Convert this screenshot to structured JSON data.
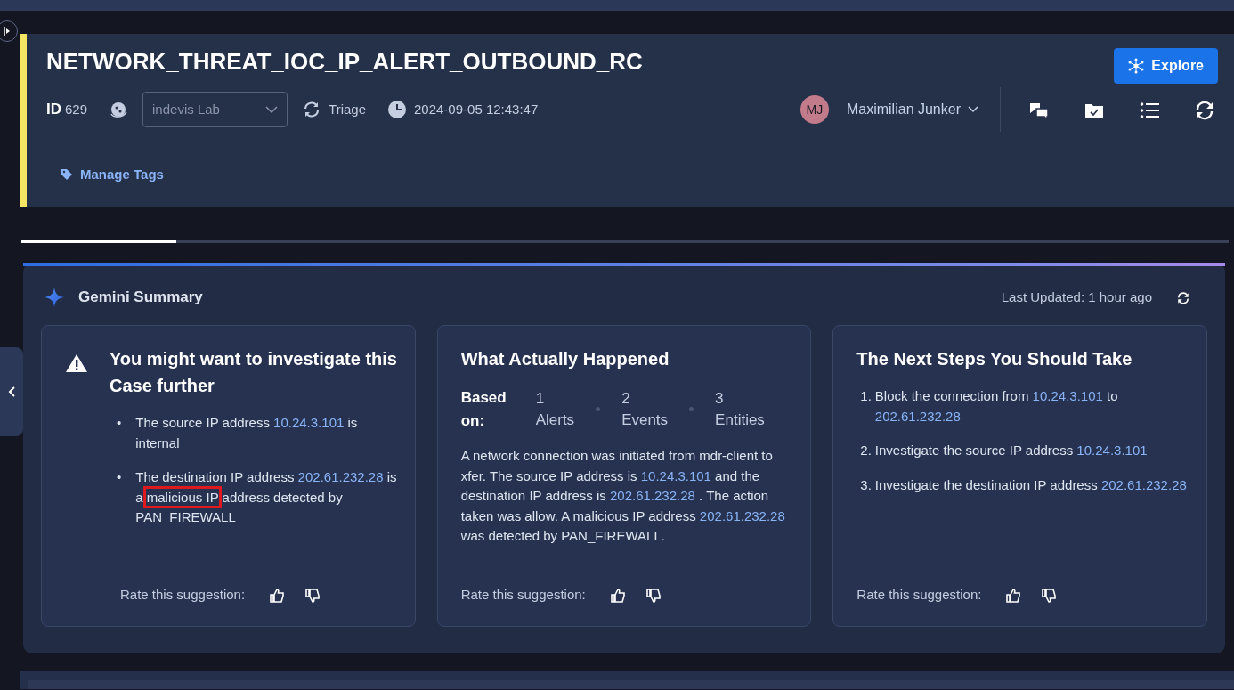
{
  "case": {
    "title": "NETWORK_THREAT_IOC_IP_ALERT_OUTBOUND_RC",
    "id_label": "ID",
    "id": "629",
    "environment": "indevis Lab",
    "stage": "Triage",
    "created": "2024-09-05 12:43:47",
    "assignee": {
      "initials": "MJ",
      "name": "Maximilian Junker"
    },
    "explore_button": "Explore",
    "manage_tags": "Manage Tags"
  },
  "summary": {
    "title": "Gemini Summary",
    "last_updated": "Last Updated: 1 hour ago",
    "cards": [
      {
        "kind": "warning",
        "title": "You might want to investigate this Case further",
        "bullets": [
          {
            "marker": "•",
            "parts": [
              {
                "kind": "text",
                "text": "The source IP address "
              },
              {
                "kind": "ip",
                "text": "10.24.3.101"
              },
              {
                "kind": "text",
                "text": " is internal"
              }
            ]
          },
          {
            "marker": "•",
            "parts": [
              {
                "kind": "text",
                "text": "The destination IP address "
              },
              {
                "kind": "ip",
                "text": "202.61.232.28"
              },
              {
                "kind": "text",
                "text": " is a "
              },
              {
                "kind": "highlight",
                "text": "malicious IP"
              },
              {
                "kind": "text",
                "text": " address detected by PAN_FIREWALL"
              }
            ]
          }
        ],
        "rating": "Rate this suggestion:"
      },
      {
        "kind": "happened",
        "title": "What Actually Happened",
        "based_on": "Based on:",
        "stats": [
          {
            "count": "1",
            "label": "Alerts"
          },
          {
            "count": "2",
            "label": "Events"
          },
          {
            "count": "3",
            "label": "Entities"
          }
        ],
        "paragraph": [
          {
            "kind": "text",
            "text": "A network connection was initiated from mdr-client to xfer. The source IP address is "
          },
          {
            "kind": "ip",
            "text": "10.24.3.101"
          },
          {
            "kind": "text",
            "text": " and the destination IP address is "
          },
          {
            "kind": "ip",
            "text": "202.61.232.28"
          },
          {
            "kind": "text",
            "text": " . The action taken was allow. A malicious IP address "
          },
          {
            "kind": "ip",
            "text": "202.61.232.28"
          },
          {
            "kind": "text",
            "text": " was detected by PAN_FIREWALL."
          }
        ],
        "rating": "Rate this suggestion:"
      },
      {
        "kind": "steps",
        "title": "The Next Steps You Should Take",
        "steps": [
          {
            "marker": "1.",
            "parts": [
              {
                "kind": "text",
                "text": "Block the connection from "
              },
              {
                "kind": "ip",
                "text": "10.24.3.101"
              },
              {
                "kind": "text",
                "text": " to "
              },
              {
                "kind": "ip",
                "text": "202.61.232.28"
              }
            ]
          },
          {
            "marker": "2.",
            "parts": [
              {
                "kind": "text",
                "text": "Investigate the source IP address "
              },
              {
                "kind": "ip",
                "text": "10.24.3.101"
              }
            ]
          },
          {
            "marker": "3.",
            "parts": [
              {
                "kind": "text",
                "text": "Investigate the destination IP address "
              },
              {
                "kind": "ip",
                "text": "202.61.232.28"
              }
            ]
          }
        ],
        "rating": "Rate this suggestion:"
      }
    ]
  }
}
